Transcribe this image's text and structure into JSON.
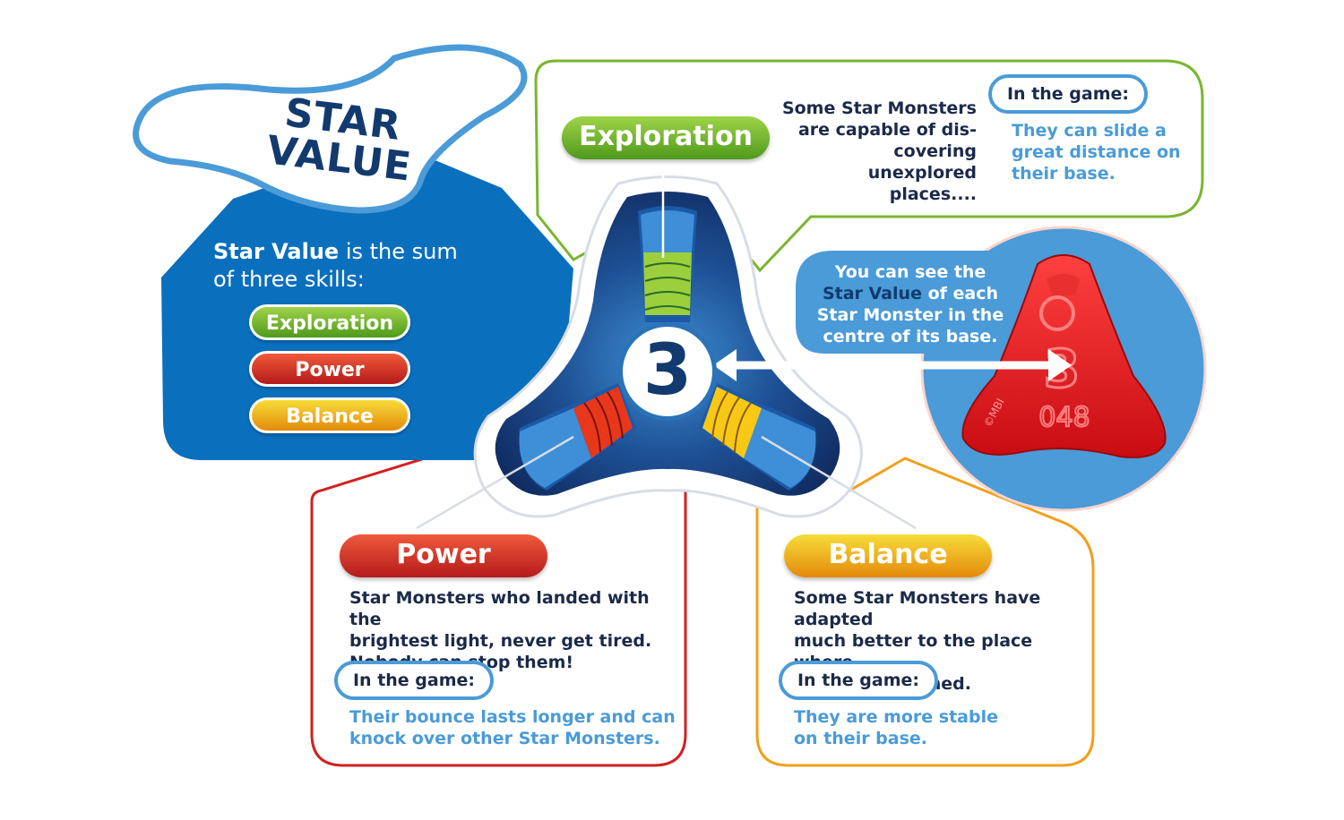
{
  "title": {
    "line1": "STAR",
    "line2": "VALUE"
  },
  "intro": {
    "strong": "Star Value",
    "rest1": " is the sum",
    "rest2": "of three skills:"
  },
  "skills_list": [
    "Exploration",
    "Power",
    "Balance"
  ],
  "center_value": "3",
  "exploration": {
    "label": "Exploration",
    "description": [
      "Some Star Monsters",
      "are capable of dis-",
      "covering",
      "unexplored",
      "places...."
    ],
    "in_game_label": "In the game:",
    "in_game_text": [
      "They can slide a",
      "great distance on",
      "their base."
    ]
  },
  "power": {
    "label": "Power",
    "description": [
      "Star Monsters who landed with the",
      "brightest light, never get tired.",
      "Nobody can stop them!"
    ],
    "in_game_label": "In the game:",
    "in_game_text": [
      "Their bounce lasts longer and can",
      "knock over other Star Monsters."
    ]
  },
  "balance": {
    "label": "Balance",
    "description": [
      "Some Star Monsters have adapted",
      "much better to the place where",
      "they were formed."
    ],
    "in_game_label": "In the game:",
    "in_game_text": [
      "They are more stable",
      "on their base."
    ]
  },
  "base_callout": {
    "line1": "You can see the",
    "strong": "Star Value",
    "line2_rest": " of each",
    "line3": "Star Monster in the",
    "line4": "centre of its base."
  },
  "base_piece": {
    "number": "3",
    "code": "048",
    "mark": "©MBI"
  },
  "colors": {
    "blue": "#0a6fbd",
    "navy": "#123a6e",
    "light_blue": "#4a9bd8",
    "green": "#6cb52c",
    "red": "#d42020",
    "orange": "#f0a01a"
  }
}
